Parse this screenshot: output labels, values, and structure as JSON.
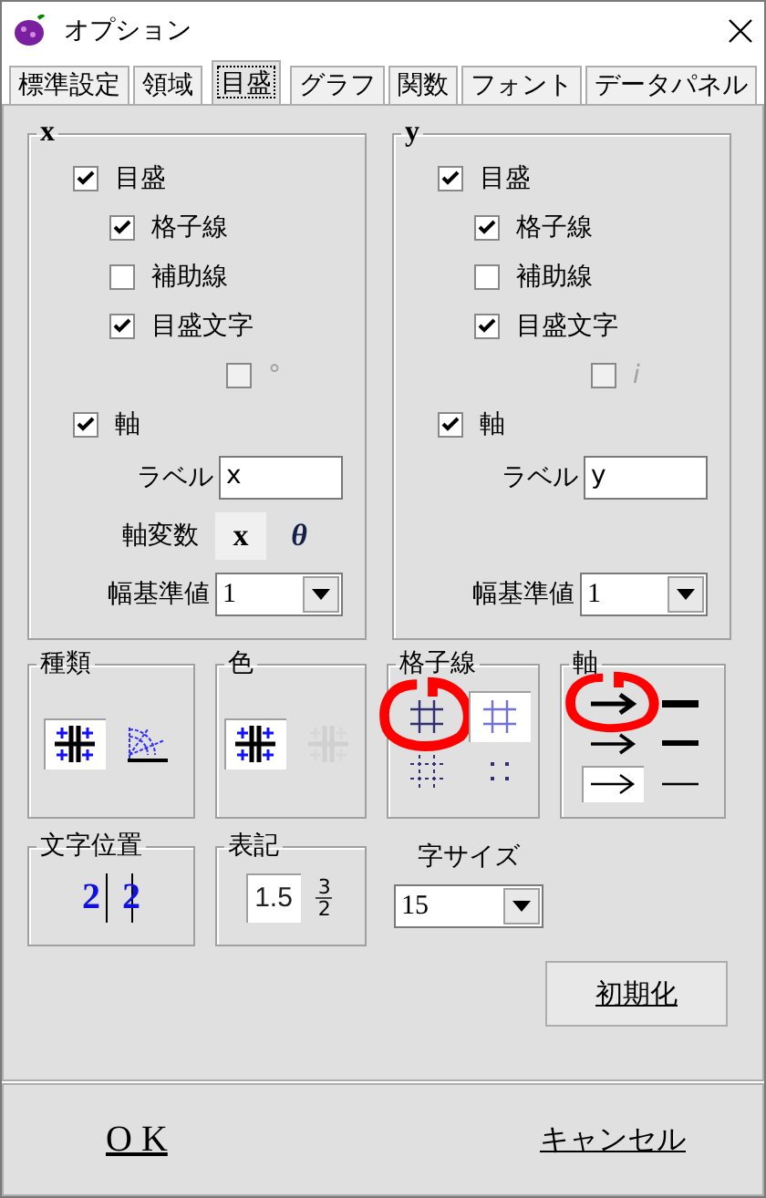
{
  "window": {
    "title": "オプション"
  },
  "tabs": [
    {
      "label": "標準設定",
      "selected": false
    },
    {
      "label": "領域",
      "selected": false
    },
    {
      "label": "目盛",
      "selected": true
    },
    {
      "label": "グラフ",
      "selected": false
    },
    {
      "label": "関数",
      "selected": false
    },
    {
      "label": "フォント",
      "selected": false
    },
    {
      "label": "データパネル",
      "selected": false
    }
  ],
  "axes": [
    {
      "title": "x",
      "checkboxes": [
        {
          "label": "目盛",
          "checked": true,
          "children": [
            {
              "label": "格子線",
              "checked": true
            },
            {
              "label": "補助線",
              "checked": false
            },
            {
              "label": "目盛文字",
              "checked": true,
              "children": [
                {
                  "label": "°",
                  "checked": false,
                  "disabled": true
                }
              ]
            }
          ]
        },
        {
          "label": "軸",
          "checked": true
        }
      ],
      "label_field": {
        "label": "ラベル",
        "value": "x"
      },
      "variable": {
        "label": "軸変数",
        "options": [
          {
            "text": "x",
            "selected": true
          },
          {
            "text": "θ",
            "selected": false
          }
        ]
      },
      "width_base": {
        "label": "幅基準値",
        "value": "1"
      }
    },
    {
      "title": "y",
      "checkboxes": [
        {
          "label": "目盛",
          "checked": true,
          "children": [
            {
              "label": "格子線",
              "checked": true
            },
            {
              "label": "補助線",
              "checked": false
            },
            {
              "label": "目盛文字",
              "checked": true,
              "children": [
                {
                  "label": "i",
                  "checked": false,
                  "disabled": true
                }
              ]
            }
          ]
        },
        {
          "label": "軸",
          "checked": true
        }
      ],
      "label_field": {
        "label": "ラベル",
        "value": "y"
      },
      "width_base": {
        "label": "幅基準値",
        "value": "1"
      }
    }
  ],
  "option_groups": [
    {
      "title": "種類",
      "options": [
        {
          "kind": "cross-grid",
          "selected": true
        },
        {
          "kind": "polar",
          "selected": false
        }
      ]
    },
    {
      "title": "色",
      "options": [
        {
          "kind": "cross-grid",
          "selected": true
        },
        {
          "kind": "grey-grid",
          "selected": false
        }
      ]
    },
    {
      "title": "格子線",
      "options": [
        {
          "kind": "dark-grid",
          "selected": false,
          "circled": true
        },
        {
          "kind": "light-grid",
          "selected": true
        },
        {
          "kind": "dashed-grid",
          "selected": false
        },
        {
          "kind": "dotted-grid",
          "selected": false
        }
      ]
    },
    {
      "title": "軸",
      "options": [
        {
          "kind": "thick-arrow",
          "selected": false,
          "circled": true
        },
        {
          "kind": "thick-line",
          "selected": false
        },
        {
          "kind": "medium-arrow",
          "selected": false
        },
        {
          "kind": "medium-line",
          "selected": false
        },
        {
          "kind": "thin-arrow",
          "selected": true
        },
        {
          "kind": "thin-line",
          "selected": false
        }
      ]
    }
  ],
  "text_groups": [
    {
      "title": "文字位置",
      "options": [
        {
          "kind": "beside",
          "text": "2",
          "selected": false
        },
        {
          "kind": "through",
          "text": "2",
          "selected": false
        }
      ]
    },
    {
      "title": "表記",
      "options": [
        {
          "kind": "decimal",
          "text": "1.5",
          "selected": true
        },
        {
          "kind": "fraction",
          "numerator": "3",
          "denominator": "2",
          "selected": false
        }
      ]
    }
  ],
  "font_size": {
    "label": "字サイズ",
    "value": "15"
  },
  "reset_button": "初期化",
  "buttons": [
    "O K",
    "キャンセル"
  ]
}
